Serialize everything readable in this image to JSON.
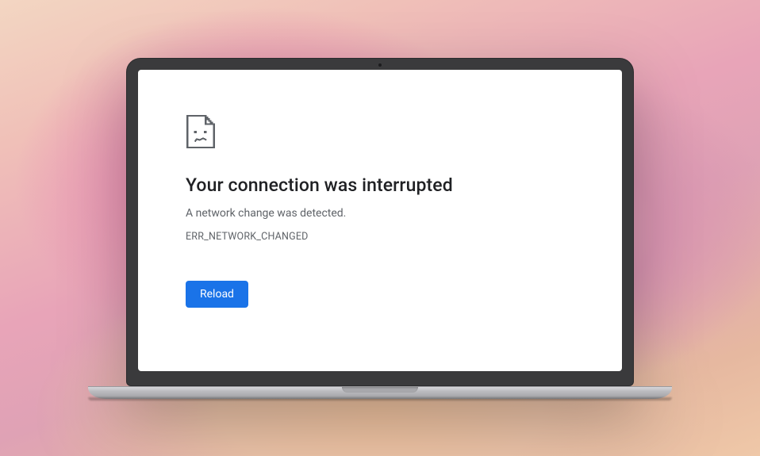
{
  "error": {
    "title": "Your connection was interrupted",
    "subtitle": "A network change was detected.",
    "code": "ERR_NETWORK_CHANGED",
    "reload_label": "Reload"
  },
  "colors": {
    "accent": "#1a73e8",
    "text_primary": "#202124",
    "text_secondary": "#5f6368"
  }
}
